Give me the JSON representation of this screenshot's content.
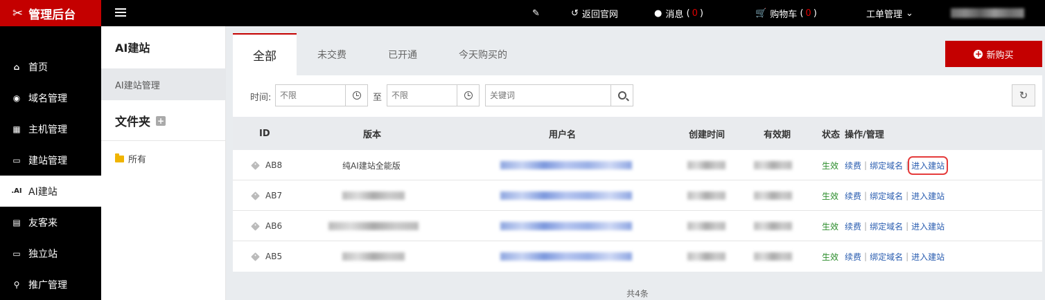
{
  "brand": {
    "title": "管理后台"
  },
  "topbar": {
    "back_label": "返回官网",
    "messages_label": "消息",
    "messages_count": "0",
    "cart_label": "购物车",
    "cart_count": "0",
    "tickets_label": "工单管理"
  },
  "sidebar": {
    "items": [
      {
        "label": "首页",
        "icon": "home-icon"
      },
      {
        "label": "域名管理",
        "icon": "globe-icon"
      },
      {
        "label": "主机管理",
        "icon": "windows-icon"
      },
      {
        "label": "建站管理",
        "icon": "monitor-icon"
      },
      {
        "label": "AI建站",
        "icon": "ai-icon",
        "icon_text": ".AI",
        "active": true
      },
      {
        "label": "友客来",
        "icon": "document-icon"
      },
      {
        "label": "独立站",
        "icon": "monitor-icon"
      },
      {
        "label": "推广管理",
        "icon": "search-icon"
      }
    ]
  },
  "subpanel": {
    "title": "AI建站",
    "link": "AI建站管理",
    "folder_title": "文件夹",
    "folder_plus": "+",
    "folder_item": "所有"
  },
  "tabs": [
    {
      "label": "全部",
      "active": true
    },
    {
      "label": "未交费"
    },
    {
      "label": "已开通"
    },
    {
      "label": "今天购买的"
    }
  ],
  "new_button": {
    "label": "新购买"
  },
  "filters": {
    "time_label": "时间:",
    "start_placeholder": "不限",
    "to_label": "至",
    "end_placeholder": "不限",
    "keyword_placeholder": "关键词"
  },
  "table": {
    "headers": {
      "id": "ID",
      "version": "版本",
      "username": "用户名",
      "created": "创建时间",
      "valid": "有效期",
      "status": "状态",
      "ops": "操作/管理"
    },
    "rows": [
      {
        "id": "AB8",
        "version": "纯AI建站全能版",
        "status": "生效",
        "op_renew": "续费",
        "op_bind": "绑定域名",
        "op_enter": "进入建站",
        "highlight": true
      },
      {
        "id": "AB7",
        "version": "",
        "status": "生效",
        "op_renew": "续费",
        "op_bind": "绑定域名",
        "op_enter": "进入建站"
      },
      {
        "id": "AB6",
        "version": "",
        "status": "生效",
        "op_renew": "续费",
        "op_bind": "绑定域名",
        "op_enter": "进入建站"
      },
      {
        "id": "AB5",
        "version": "",
        "status": "生效",
        "op_renew": "续费",
        "op_bind": "绑定域名",
        "op_enter": "进入建站"
      }
    ]
  },
  "footer": {
    "total": "共4条"
  },
  "colors": {
    "brand": "#c40000",
    "link": "#2a5db0",
    "status_ok": "#2a8c2a",
    "highlight": "#e53b3b"
  }
}
